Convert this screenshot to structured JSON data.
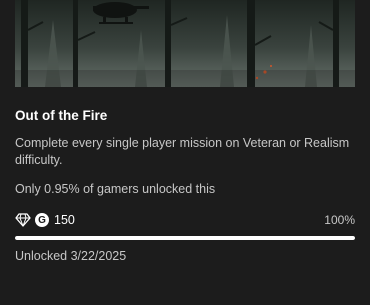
{
  "achievement": {
    "title": "Out of the Fire",
    "description": "Complete every single player mission on Veteran or Realism difficulty.",
    "rarity_text": "Only 0.95% of gamers unlocked this",
    "gamerscore_badge": "G",
    "gamerscore": "150",
    "progress_text": "100%",
    "progress": 1.0,
    "unlocked_text": "Unlocked 3/22/2025"
  },
  "icons": {
    "rarity": "diamond-icon",
    "gamerscore": "gamerscore-icon"
  },
  "colors": {
    "background": "#1c1c1c",
    "progress_fill": "#ffffff",
    "progress_track": "#4a4a4a",
    "secondary_text": "#c7c7c7"
  }
}
